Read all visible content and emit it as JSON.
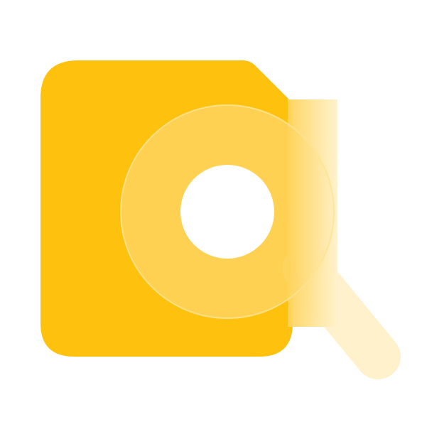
{
  "icon": {
    "name": "file-search-icon",
    "colors": {
      "document": "#FDC10E",
      "lens": "#FFD359",
      "lens_rim": "#FFE391",
      "handle": "#FFF1CC",
      "hole": "#FFFFFF",
      "background": "#FFFFFF"
    }
  }
}
